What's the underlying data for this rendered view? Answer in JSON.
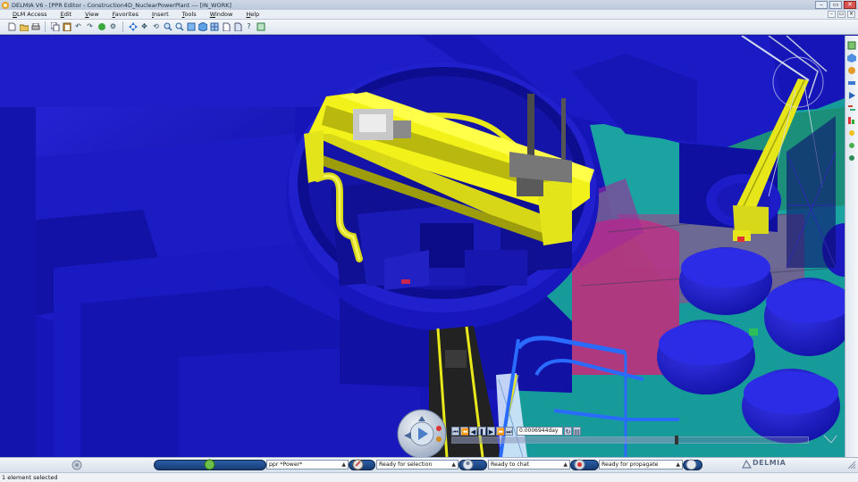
{
  "window": {
    "title": "DELMIA V6 - [PPR Editor - Construction4D_NuclearPowerPlant --- [IN_WORK]",
    "controls": [
      "–",
      "▭",
      "✕"
    ]
  },
  "menu": {
    "items": [
      {
        "label": "DLM Access",
        "underline": "D"
      },
      {
        "label": "Edit",
        "underline": "E"
      },
      {
        "label": "View",
        "underline": "V"
      },
      {
        "label": "Favorites",
        "underline": "F"
      },
      {
        "label": "Insert",
        "underline": "I"
      },
      {
        "label": "Tools",
        "underline": "T"
      },
      {
        "label": "Window",
        "underline": "W"
      },
      {
        "label": "Help",
        "underline": "H"
      }
    ]
  },
  "toolbar": {
    "icons": [
      "new-icon",
      "open-icon",
      "print-icon",
      "copy-icon",
      "paste-icon",
      "undo-icon",
      "redo-icon",
      "refresh-icon",
      "settings-icon",
      "fit-all-icon",
      "pan-icon",
      "rotate-icon",
      "zoom-in-icon",
      "zoom-out-icon",
      "normal-view-icon",
      "iso-view-icon",
      "render-style-icon",
      "hide-show-icon",
      "swap-visible-icon",
      "help-icon",
      "measure-icon"
    ]
  },
  "playback": {
    "time_value": "0.0006944day",
    "timeline_progress": 0.63
  },
  "bottom": {
    "combo_ppr": "ppr *Power*",
    "combo_selection": "Ready for selection",
    "combo_chat": "Ready to chat",
    "combo_propagate": "Ready for propagate",
    "brand": "DELMIA"
  },
  "status": {
    "text": "1 element selected"
  },
  "colors": {
    "scene_blue": "#1818c6",
    "crane_yellow": "#f2f21a",
    "floor_teal": "#1aa3a0",
    "floor_magenta": "#cc2e7a"
  }
}
